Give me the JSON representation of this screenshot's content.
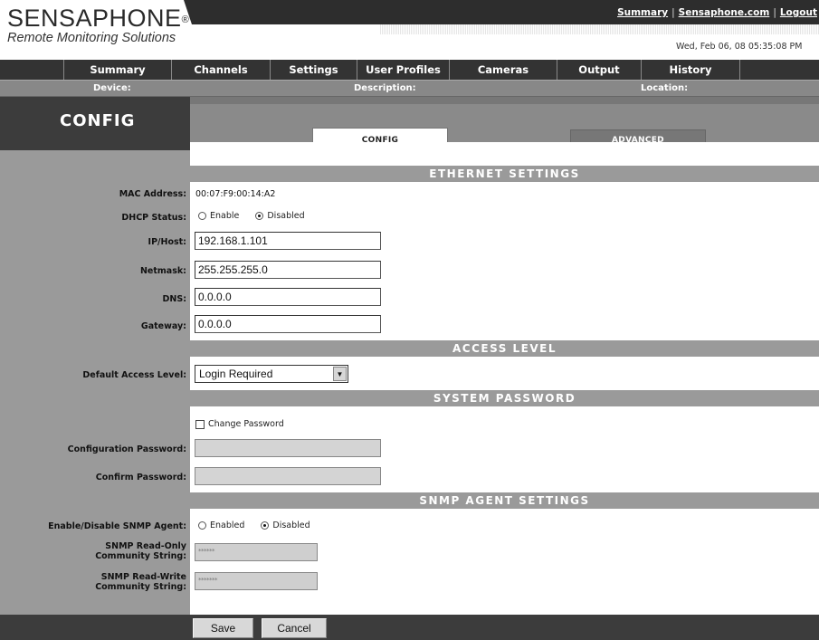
{
  "header": {
    "logo_main": "SENSAPHONE",
    "logo_mark": "®",
    "logo_sub": "Remote Monitoring Solutions",
    "links": [
      "Summary",
      "Sensaphone.com",
      "Logout"
    ],
    "link_separator": "|",
    "datetime": "Wed, Feb 06, 08 05:35:08 PM"
  },
  "nav": [
    "Summary",
    "Channels",
    "Settings",
    "User Profiles",
    "Cameras",
    "Output",
    "History"
  ],
  "device_bar": {
    "device": "Device:",
    "description": "Description:",
    "location": "Location:"
  },
  "page_title": "CONFIG",
  "tabs": {
    "active": "CONFIG",
    "inactive": "ADVANCED"
  },
  "ethernet": {
    "heading": "ETHERNET SETTINGS",
    "mac_label": "MAC Address:",
    "mac_value": "00:07:F9:00:14:A2",
    "dhcp_label": "DHCP Status:",
    "dhcp_enable": "Enable",
    "dhcp_disabled": "Disabled",
    "ip_label": "IP/Host:",
    "ip_value": "192.168.1.101",
    "netmask_label": "Netmask:",
    "netmask_value": "255.255.255.0",
    "dns_label": "DNS:",
    "dns_value": "0.0.0.0",
    "gateway_label": "Gateway:",
    "gateway_value": "0.0.0.0"
  },
  "access": {
    "heading": "ACCESS LEVEL",
    "label": "Default Access Level:",
    "selected": "Login Required"
  },
  "password": {
    "heading": "SYSTEM PASSWORD",
    "change_label": "Change Password",
    "config_label": "Configuration Password:",
    "confirm_label": "Confirm Password:"
  },
  "snmp": {
    "heading": "SNMP AGENT SETTINGS",
    "enable_label": "Enable/Disable SNMP Agent:",
    "enabled": "Enabled",
    "disabled": "Disabled",
    "ro_label_1": "SNMP Read-Only",
    "ro_label_2": "Community String:",
    "ro_value": "******",
    "rw_label_1": "SNMP Read-Write",
    "rw_label_2": "Community String:",
    "rw_value": "*******"
  },
  "buttons": {
    "save": "Save",
    "cancel": "Cancel"
  }
}
